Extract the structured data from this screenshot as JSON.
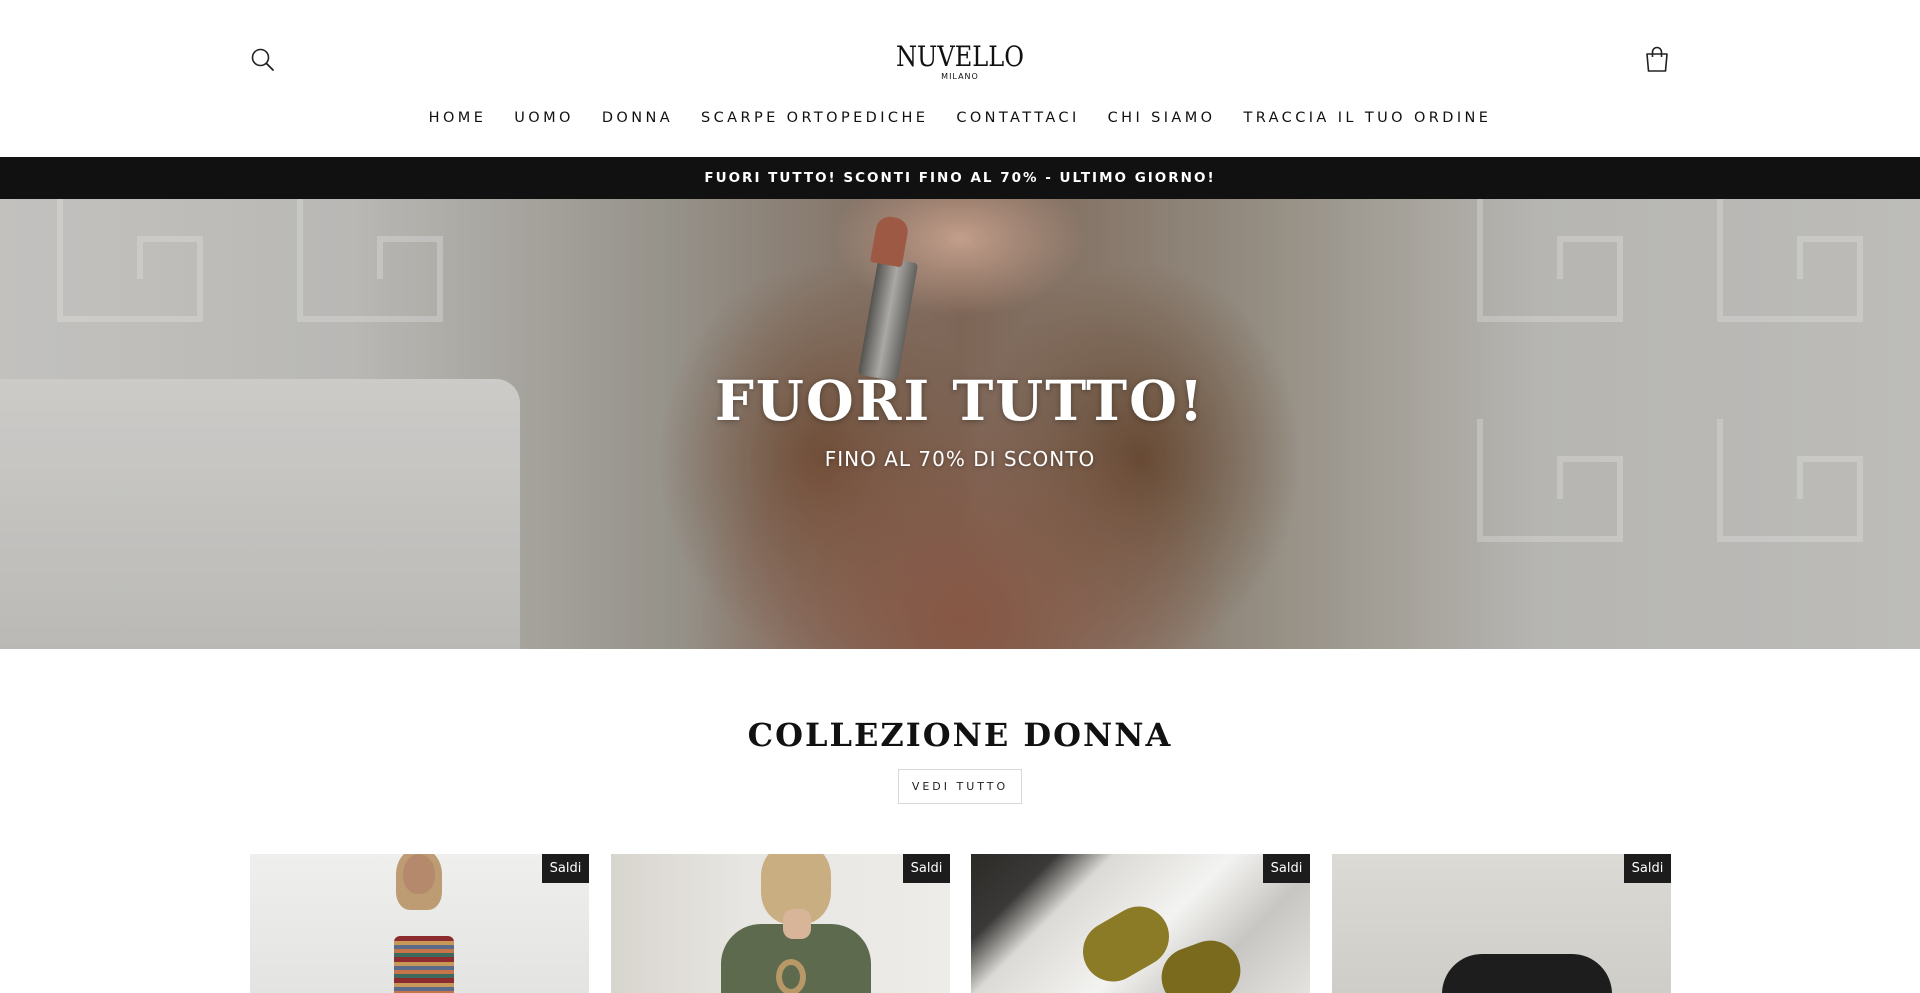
{
  "brand": {
    "name": "NUVELLO",
    "city": "MILANO"
  },
  "header": {
    "search_icon": "search-icon",
    "cart_icon": "shopping-bag-icon"
  },
  "nav": {
    "items": [
      {
        "label": "HOME"
      },
      {
        "label": "UOMO"
      },
      {
        "label": "DONNA"
      },
      {
        "label": "SCARPE ORTOPEDICHE"
      },
      {
        "label": "CONTATTACI"
      },
      {
        "label": "CHI SIAMO"
      },
      {
        "label": "TRACCIA IL TUO ORDINE"
      }
    ]
  },
  "announcement": {
    "text": "FUORI TUTTO! SCONTI FINO AL 70% - ULTIMO GIORNO!"
  },
  "hero": {
    "title": "FUORI TUTTO!",
    "subtitle": "FINO AL 70% DI SCONTO"
  },
  "collection": {
    "title": "COLLEZIONE DONNA",
    "view_all_label": "VEDI TUTTO",
    "products": [
      {
        "badge": "Saldi"
      },
      {
        "badge": "Saldi"
      },
      {
        "badge": "Saldi"
      },
      {
        "badge": "Saldi"
      }
    ]
  },
  "colors": {
    "announcement_bg": "#111111",
    "badge_bg": "#1c1c1c",
    "text": "#111111"
  }
}
